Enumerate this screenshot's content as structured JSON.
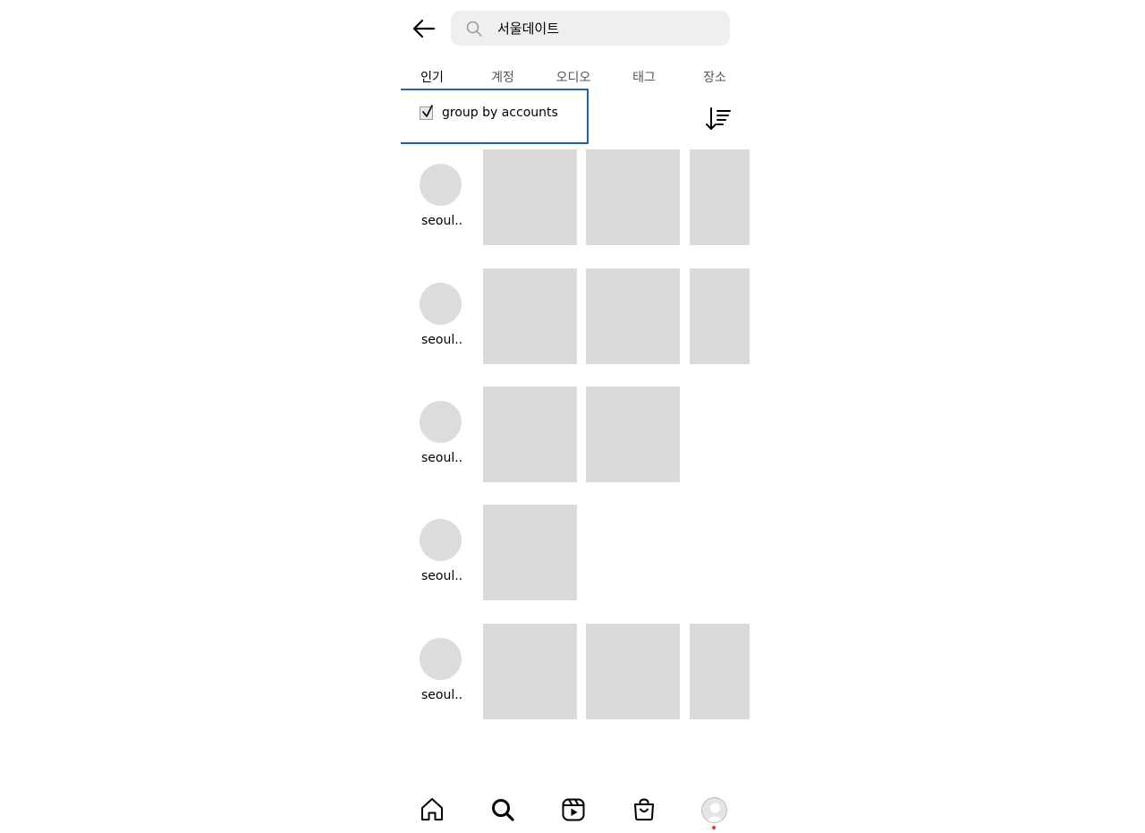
{
  "search": {
    "query": "서울데이트"
  },
  "tabs": [
    {
      "label": "인기",
      "active": true
    },
    {
      "label": "계정",
      "active": false
    },
    {
      "label": "오디오",
      "active": false
    },
    {
      "label": "태그",
      "active": false
    },
    {
      "label": "장소",
      "active": false
    }
  ],
  "group_toggle": {
    "label": "group by accounts",
    "checked": true
  },
  "results": [
    {
      "username": "seoul..",
      "thumbnails": 3
    },
    {
      "username": "seoul..",
      "thumbnails": 3
    },
    {
      "username": "seoul..",
      "thumbnails": 2
    },
    {
      "username": "seoul..",
      "thumbnails": 1
    },
    {
      "username": "seoul..",
      "thumbnails": 3
    }
  ],
  "bottom_nav": [
    {
      "icon": "home-icon"
    },
    {
      "icon": "search-icon",
      "active": true
    },
    {
      "icon": "reels-icon"
    },
    {
      "icon": "shop-icon"
    },
    {
      "icon": "profile-avatar",
      "notification": true
    }
  ],
  "colors": {
    "highlight_border": "#1f65a5",
    "placeholder": "#d9d9d9",
    "notification": "#ed2d3a"
  }
}
